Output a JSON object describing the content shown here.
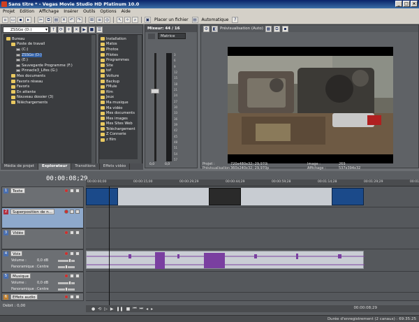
{
  "window": {
    "title": "Sans titre * - Vegas Movie Studio HD Platinum 10.0",
    "controls": [
      "_",
      "□",
      "×"
    ]
  },
  "menu": [
    "Projet",
    "Edition",
    "Affichage",
    "Insérer",
    "Outils",
    "Options",
    "Aide"
  ],
  "toolbar": {
    "picture_in_file": "Placer un fichier",
    "auto": "Automatique"
  },
  "explorer": {
    "drive": "ZSSGo (D:)",
    "tree": [
      {
        "label": "Bureau",
        "indent": 0,
        "kind": "folder"
      },
      {
        "label": "Poste de travail",
        "indent": 1,
        "kind": "folder"
      },
      {
        "label": "(C:)",
        "indent": 2,
        "kind": "drive"
      },
      {
        "label": "ZSSGo (D:)",
        "indent": 2,
        "kind": "drive",
        "selected": true
      },
      {
        "label": "(E:)",
        "indent": 2,
        "kind": "drive"
      },
      {
        "label": "Sauvegarde Programme (F:)",
        "indent": 2,
        "kind": "drive"
      },
      {
        "label": "Pinnacle3_Lifes (G:)",
        "indent": 2,
        "kind": "drive"
      },
      {
        "label": "Mes documents",
        "indent": 1,
        "kind": "folder"
      },
      {
        "label": "Favoris réseau",
        "indent": 1,
        "kind": "folder"
      },
      {
        "label": "Favoris",
        "indent": 1,
        "kind": "folder"
      },
      {
        "label": "En attente",
        "indent": 1,
        "kind": "folder"
      },
      {
        "label": "Nouveau dossier (3)",
        "indent": 1,
        "kind": "folder"
      },
      {
        "label": "Téléchargements",
        "indent": 1,
        "kind": "folder"
      }
    ],
    "files": [
      "Installation",
      "Matos",
      "Photos",
      "Pilotes",
      "Programmes",
      "Site",
      "tof",
      "Voiture",
      "Backup",
      "FMule",
      "film",
      "Jeux",
      "Ma musique",
      "Ma vidéo",
      "Mes documents",
      "Mes images",
      "Mes Sites Web",
      "Téléchargement",
      "Z Connerie",
      "z film"
    ]
  },
  "bottom_tabs": [
    "Média de projet",
    "Explorateur",
    "Transitions",
    "Effets vidéo"
  ],
  "mixer": {
    "header": "Mixeur:",
    "header_value": "44 / 16",
    "channel": "Matrice",
    "scale": [
      "3",
      "6",
      "9",
      "12",
      "15",
      "18",
      "21",
      "24",
      "27",
      "30",
      "33",
      "36",
      "39",
      "42",
      "45",
      "48",
      "51",
      "54",
      "57"
    ],
    "bottom_left": "0,0",
    "bottom_right": "0,0"
  },
  "preview": {
    "mode": "Prévisualisation (Auto)",
    "project_label": "Projet :",
    "project_value": "720x480x32; 29,970i",
    "preview_label": "Prévisualisation :",
    "preview_value": "360x240x32; 29,970p",
    "image_label": "Image :",
    "image_value": "269",
    "display_label": "Affichage :",
    "display_value": "537x394x32"
  },
  "timeline": {
    "timecode": "00:00:08;29",
    "ruler": [
      "00:00:00;00",
      "00:00:15;00",
      "00:00:29;29",
      "00:00:44;29",
      "00:00:59;28",
      "00:01:14;28",
      "00:01:29;29",
      "00:01:44;29"
    ],
    "tracks": [
      {
        "num": "1",
        "name": "Texte",
        "type": "video"
      },
      {
        "num": "2",
        "name": "Superposition de n...",
        "type": "video"
      },
      {
        "num": "3",
        "name": "Vidéo",
        "type": "video"
      },
      {
        "num": "4",
        "name": "Voix",
        "type": "audio",
        "volume_label": "Volume :",
        "volume": "0,0 dB",
        "pan_label": "Panoramique :",
        "pan": "Centre"
      },
      {
        "num": "5",
        "name": "Musique",
        "type": "audio",
        "volume_label": "Volume :",
        "volume": "0,0 dB",
        "pan_label": "Panoramique :",
        "pan": "Centre"
      },
      {
        "num": "6",
        "name": "Effets audio",
        "type": "audio"
      }
    ],
    "rate": "Débit : 0,00",
    "time_display": "00:00:08;29",
    "status": "Durée d'enregistrement (2 canaux) : 69:35:25"
  },
  "colors": {
    "accent": "#1b3f7a",
    "timeline_bg": "#5b5e62",
    "wave": "#7a3fa0"
  }
}
